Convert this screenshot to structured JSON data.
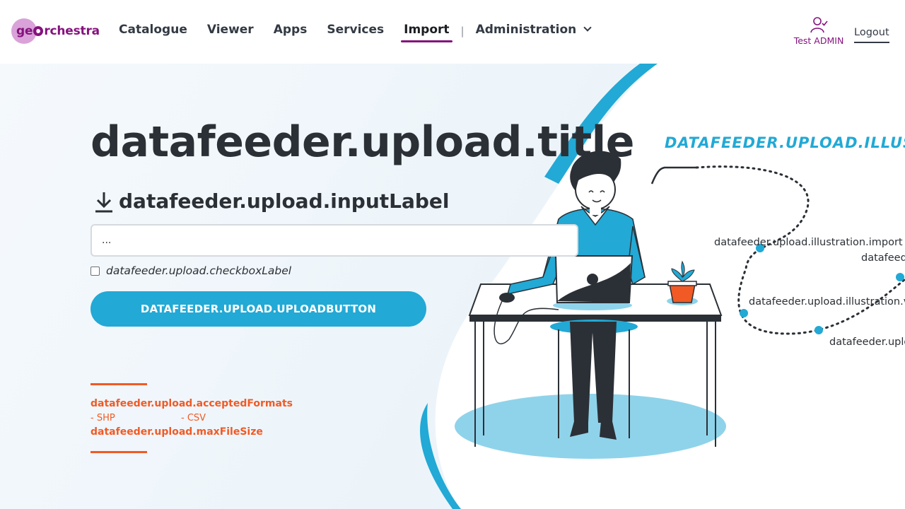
{
  "header": {
    "logo": {
      "text_before": "ge",
      "text_after": "rchestra"
    },
    "nav": [
      "Catalogue",
      "Viewer",
      "Apps",
      "Services",
      "Import"
    ],
    "nav_separator": "|",
    "nav_dropdown": "Administration",
    "active_item": "Import",
    "user_name": "Test ADMIN",
    "logout_label": "Logout"
  },
  "upload": {
    "title": "datafeeder.upload.title",
    "input_label": "datafeeder.upload.inputLabel",
    "input_value": "...",
    "checkbox_label": "datafeeder.upload.checkboxLabel",
    "checkbox_checked": false,
    "upload_button": "DATAFEEDER.UPLOAD.UPLOADBUTTON",
    "accepted_formats_title": "datafeeder.upload.acceptedFormats",
    "formats": [
      "- SHP",
      "- CSV"
    ],
    "max_file_size": "datafeeder.upload.maxFileSize"
  },
  "illustration": {
    "title": "DATAFEEDER.UPLOAD.ILLUSTR",
    "steps": [
      "datafeeder.upload.illustration.import",
      "datafeede",
      "datafeeder.upload.illustration.ve",
      "datafeeder.uplo"
    ]
  },
  "colors": {
    "brand": "#85127e",
    "accent": "#22a9d5",
    "orange": "#f15a24",
    "text": "#2b3036"
  }
}
